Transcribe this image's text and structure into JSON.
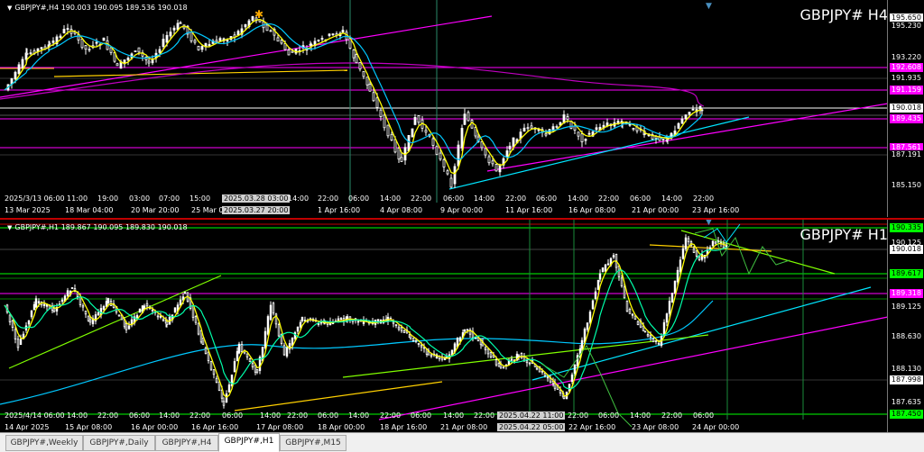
{
  "h4": {
    "ohlc_text": "GBPJPY#,H4  190.003 190.095 189.536 190.018",
    "symbol_label": "GBPJPY# H4",
    "price_labels": [
      {
        "text": "195.650",
        "style": "white"
      },
      {
        "text": "195.230",
        "style": "plain"
      },
      {
        "text": "193.220",
        "style": "plain"
      },
      {
        "text": "192.608",
        "style": "mag"
      },
      {
        "text": "191.935",
        "style": "plain"
      },
      {
        "text": "191.159",
        "style": "mag"
      },
      {
        "text": "190.018",
        "style": "white"
      },
      {
        "text": "189.435",
        "style": "mag"
      },
      {
        "text": "187.561",
        "style": "mag"
      },
      {
        "text": "187.191",
        "style": "plain"
      },
      {
        "text": "185.150",
        "style": "plain"
      }
    ],
    "time_labels": [
      "2025/3/13 06:00",
      "11:00",
      "19:00",
      "03:00",
      "07:00",
      "15:00",
      "2025.03.28 03:00",
      "14:00",
      "22:00",
      "06:00",
      "14:00",
      "22:00",
      "06:00",
      "14:00",
      "22:00",
      "06:00",
      "14:00",
      "22:00",
      "06:00",
      "14:00",
      "22:00"
    ],
    "date_labels": [
      "13 Mar 2025",
      "18 Mar 04:00",
      "20 Mar 20:00",
      "25 Mar 0",
      "2025.03.27 20:00",
      "1 Apr 16:00",
      "4 Apr 08:00",
      "9 Apr 00:00",
      "11 Apr 16:00",
      "16 Apr 08:00",
      "21 Apr 00:00",
      "23 Apr 16:00"
    ]
  },
  "h1": {
    "ohlc_text": "GBPJPY#,H1  189.867 190.095 189.830 190.018",
    "symbol_label": "GBPJPY# H1",
    "price_labels": [
      {
        "text": "190.335",
        "style": "grn"
      },
      {
        "text": "190.125",
        "style": "plain"
      },
      {
        "text": "190.018",
        "style": "white"
      },
      {
        "text": "189.617",
        "style": "grn"
      },
      {
        "text": "189.318",
        "style": "mag"
      },
      {
        "text": "189.125",
        "style": "plain"
      },
      {
        "text": "188.630",
        "style": "plain"
      },
      {
        "text": "188.130",
        "style": "plain"
      },
      {
        "text": "187.998",
        "style": "white"
      },
      {
        "text": "187.635",
        "style": "plain"
      },
      {
        "text": "187.450",
        "style": "grn"
      }
    ],
    "time_labels": [
      "2025/4/14 06:00",
      "14:00",
      "22:00",
      "06:00",
      "14:00",
      "22:00",
      "06:00",
      "14:00",
      "22:00",
      "06:00",
      "14:00",
      "22:00",
      "06:00",
      "14:00",
      "22:00",
      "06:00",
      "2025.04.22 11:00",
      "22:00",
      "06:00",
      "14:00",
      "22:00",
      "06:00"
    ],
    "date_labels": [
      "14 Apr 2025",
      "15 Apr 08:00",
      "16 Apr 00:00",
      "16 Apr 16:00",
      "17 Apr 08:00",
      "18 Apr 00:00",
      "18 Apr 16:00",
      "21 Apr 08:00",
      "2025.04.22 05:00",
      "22 Apr 16:00",
      "23 Apr 08:00",
      "24 Apr 00:00"
    ]
  },
  "tabs": [
    "GBPJPY#,Weekly",
    "GBPJPY#,Daily",
    "GBPJPY#,H4",
    "GBPJPY#,H1",
    "GBPJPY#,M15"
  ],
  "active_tab": "GBPJPY#,H1",
  "colors": {
    "candle": "#ffffff",
    "ma_fast": "#ffff00",
    "ma_mid": "#00ffaa",
    "ma_slow": "#00c8ff",
    "ma_long": "#c000c0",
    "trend_mag": "#ff00ff",
    "trend_cyan": "#00e5ff",
    "trend_green": "#80ff00",
    "level_line": "#ff00ff"
  }
}
